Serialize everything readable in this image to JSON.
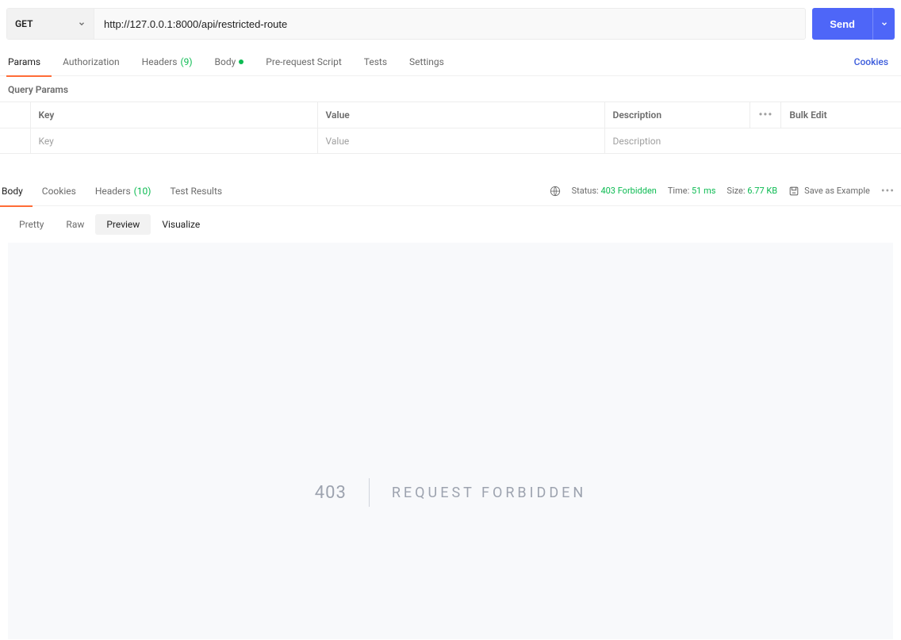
{
  "request": {
    "method": "GET",
    "url": "http://127.0.0.1:8000/api/restricted-route",
    "send_label": "Send"
  },
  "req_tabs": {
    "params": "Params",
    "authorization": "Authorization",
    "headers": "Headers",
    "headers_count": "(9)",
    "body": "Body",
    "prerequest": "Pre-request Script",
    "tests": "Tests",
    "settings": "Settings",
    "cookies_link": "Cookies"
  },
  "query_params": {
    "title": "Query Params",
    "headers": {
      "key": "Key",
      "value": "Value",
      "description": "Description",
      "bulk_edit": "Bulk Edit"
    },
    "row_placeholders": {
      "key": "Key",
      "value": "Value",
      "description": "Description"
    }
  },
  "resp_tabs": {
    "body": "Body",
    "cookies": "Cookies",
    "headers": "Headers",
    "headers_count": "(10)",
    "test_results": "Test Results"
  },
  "resp_meta": {
    "status_label": "Status:",
    "status_value": "403 Forbidden",
    "time_label": "Time:",
    "time_value": "51 ms",
    "size_label": "Size:",
    "size_value": "6.77 KB",
    "save_example": "Save as Example"
  },
  "view_tabs": {
    "pretty": "Pretty",
    "raw": "Raw",
    "preview": "Preview",
    "visualize": "Visualize"
  },
  "preview": {
    "code": "403",
    "text": "REQUEST FORBIDDEN"
  }
}
